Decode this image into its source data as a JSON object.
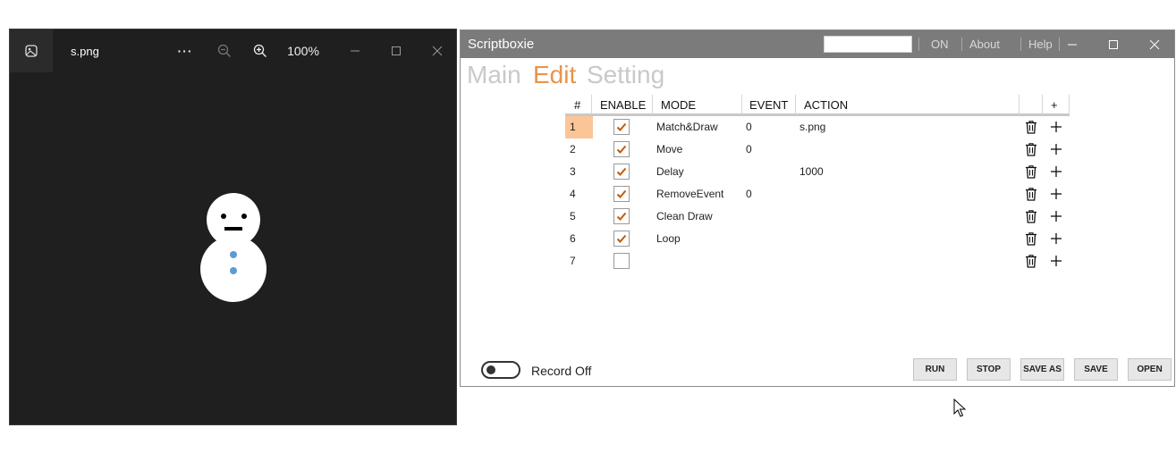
{
  "viewer": {
    "filename": "s.png",
    "more_label": "···",
    "zoom_level": "100%"
  },
  "scriptboxie": {
    "title": "Scriptboxie",
    "search_value": "",
    "menu": {
      "on": "ON",
      "about": "About",
      "help": "Help"
    },
    "tabs": [
      {
        "label": "Main",
        "active": false
      },
      {
        "label": "Edit",
        "active": true
      },
      {
        "label": "Setting",
        "active": false
      }
    ],
    "columns": [
      "#",
      "ENABLE",
      "MODE",
      "EVENT",
      "ACTION",
      "",
      "+"
    ],
    "rows": [
      {
        "num": "1",
        "enabled": true,
        "mode": "Match&Draw",
        "event": "0",
        "action": "s.png"
      },
      {
        "num": "2",
        "enabled": true,
        "mode": "Move",
        "event": "0",
        "action": ""
      },
      {
        "num": "3",
        "enabled": true,
        "mode": "Delay",
        "event": "",
        "action": "1000"
      },
      {
        "num": "4",
        "enabled": true,
        "mode": "RemoveEvent",
        "event": "0",
        "action": ""
      },
      {
        "num": "5",
        "enabled": true,
        "mode": "Clean Draw",
        "event": "",
        "action": ""
      },
      {
        "num": "6",
        "enabled": true,
        "mode": "Loop",
        "event": "",
        "action": ""
      },
      {
        "num": "7",
        "enabled": false,
        "mode": "",
        "event": "",
        "action": ""
      }
    ],
    "record_label": "Record Off",
    "record_on": false,
    "buttons": {
      "run": "RUN",
      "stop": "STOP",
      "save_as": "SAVE AS",
      "save": "SAVE",
      "open": "OPEN"
    }
  },
  "colors": {
    "accent": "#e8944a",
    "selected_row": "#fcc597",
    "titlebar": "#7b7b7b",
    "viewer_bg": "#1f1f1f",
    "snowman": "#ffffff",
    "snowman_buttons": "#5b9bd5"
  }
}
